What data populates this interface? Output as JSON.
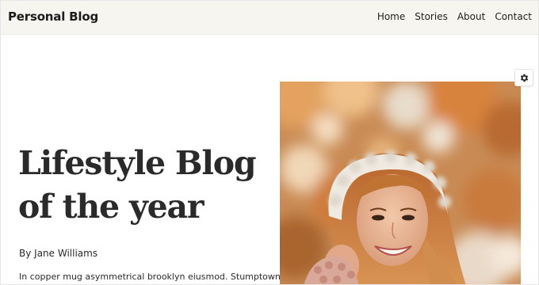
{
  "header": {
    "site_title": "Personal Blog",
    "nav": [
      {
        "label": "Home"
      },
      {
        "label": "Stories"
      },
      {
        "label": "About"
      },
      {
        "label": "Contact"
      }
    ],
    "background": "#f6f5f0"
  },
  "hero": {
    "title_line1": "Lifestyle Blog",
    "title_line2": "of the year",
    "byline": "By Jane Williams",
    "excerpt": "In copper mug asymmetrical brooklyn eiusmod. Stumptown"
  },
  "photo": {
    "icon": "hero-photo-woman-white-hat-autumn"
  },
  "settings": {
    "icon": "gear-icon"
  }
}
